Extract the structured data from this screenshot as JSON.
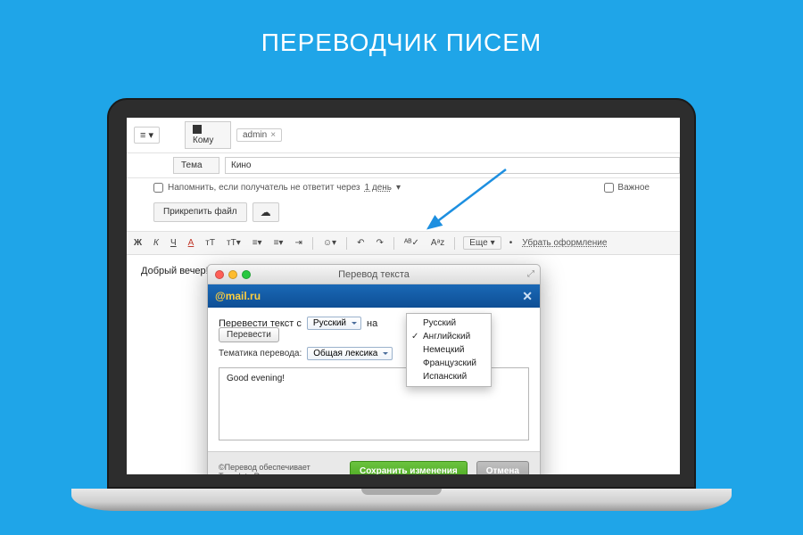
{
  "hero": {
    "title": "ПЕРЕВОДЧИК ПИСЕМ"
  },
  "compose": {
    "menu_glyph": "≡ ▾",
    "to_label": "Кому",
    "recipient": "admin",
    "subject_label": "Тема",
    "subject_value": "Кино",
    "reminder_prefix": "Напомнить, если получатель не ответит через",
    "reminder_value": "1 день",
    "important_label": "Важное",
    "attach_label": "Прикрепить файл",
    "cloud_glyph": "☁",
    "body_text": "Добрый вечер!"
  },
  "toolbar": {
    "bold": "Ж",
    "italic": "К",
    "underline": "Ч",
    "color": "A",
    "fontsize": "тТ",
    "fontcase": "тТ▾",
    "align": "≡▾",
    "list": "≡▾",
    "indent": "⇥",
    "emoji": "☺▾",
    "undo": "↶",
    "redo": "↷",
    "spell": "ᴬᴮ✓",
    "translate": "Аᵃz",
    "more": "Еще",
    "remove_style": "Убрать оформление"
  },
  "dialog": {
    "window_title": "Перевод текста",
    "brand": "@mail.ru",
    "line_prefix": "Перевести текст с",
    "from_lang": "Русский",
    "line_mid": "на",
    "translate_btn": "Перевести",
    "topic_label": "Тематика перевода:",
    "topic_value": "Общая лексика",
    "result_text": "Good evening!",
    "credit": "©Перевод обеспечивает Translate.Ru",
    "save_btn": "Сохранить изменения",
    "cancel_btn": "Отмена",
    "languages": [
      "Русский",
      "Английский",
      "Немецкий",
      "Французский",
      "Испанский"
    ],
    "selected_index": 1
  }
}
